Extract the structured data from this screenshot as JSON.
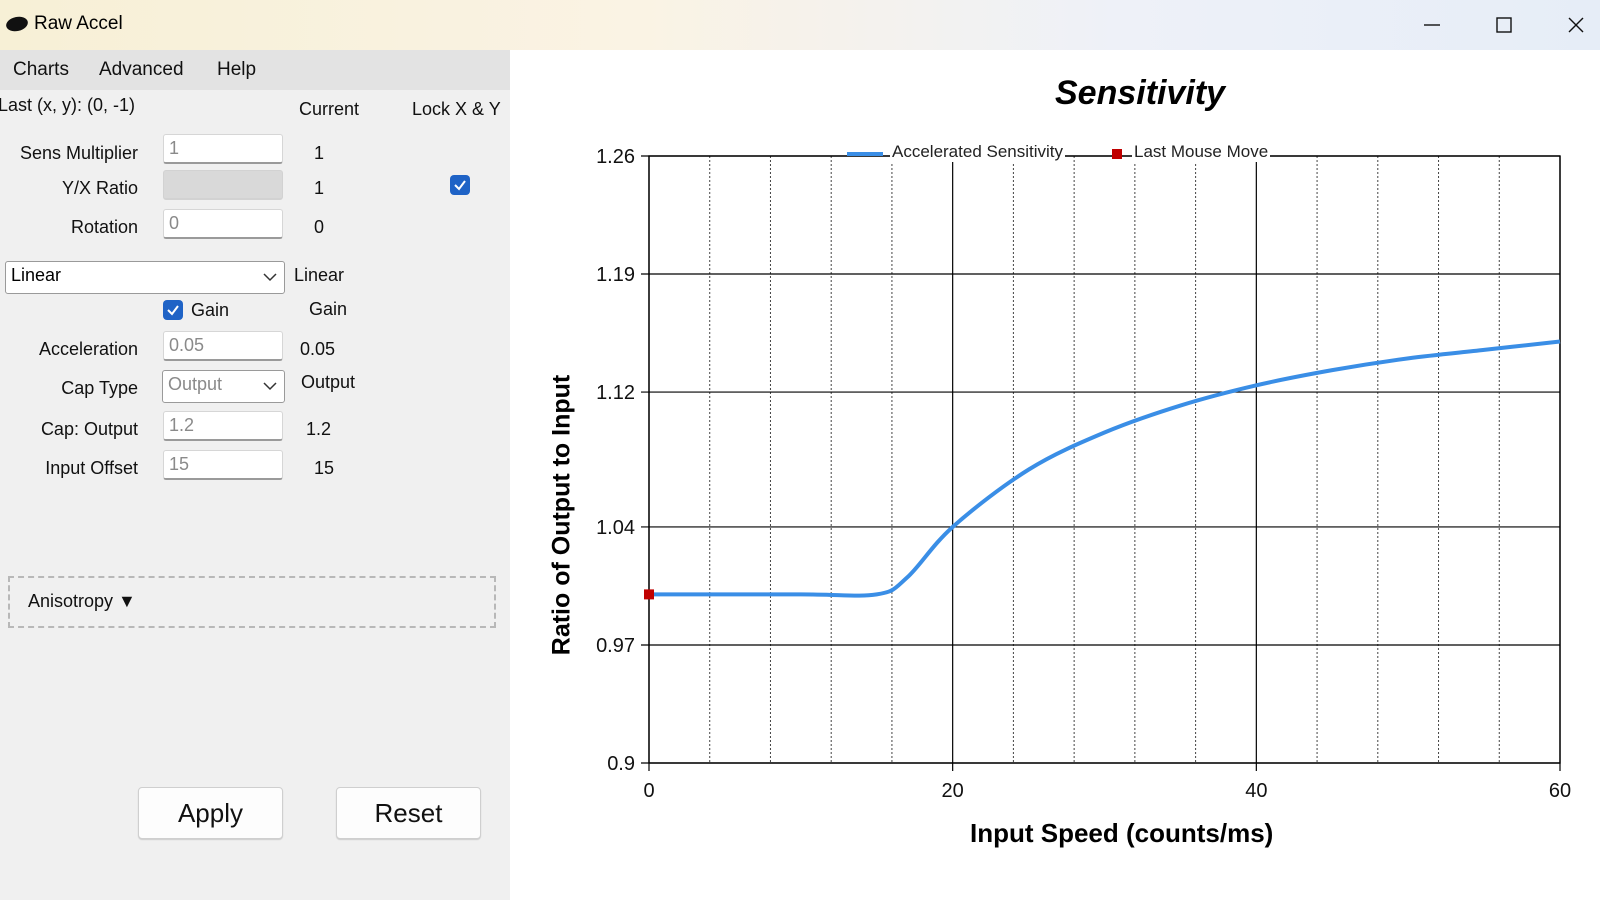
{
  "app": {
    "title": "Raw Accel"
  },
  "menu": {
    "items": [
      "Charts",
      "Advanced",
      "Help"
    ]
  },
  "panel": {
    "last_xy": "Last (x, y): (0, -1)",
    "current_header": "Current",
    "lock_header": "Lock X & Y",
    "sens_label": "Sens Multiplier",
    "sens_value": "1",
    "sens_current": "1",
    "yx_label": "Y/X Ratio",
    "yx_value": "",
    "yx_current": "1",
    "rotation_label": "Rotation",
    "rotation_value": "0",
    "rotation_current": "0",
    "mode_value": "Linear",
    "mode_current": "Linear",
    "gain_label": "Gain",
    "gain_current": "Gain",
    "accel_label": "Acceleration",
    "accel_value": "0.05",
    "accel_current": "0.05",
    "captype_label": "Cap Type",
    "captype_value": "Output",
    "captype_current": "Output",
    "capout_label": "Cap: Output",
    "capout_value": "1.2",
    "capout_current": "1.2",
    "offset_label": "Input Offset",
    "offset_value": "15",
    "offset_current": "15",
    "aniso_label": "Anisotropy ▼",
    "apply_label": "Apply",
    "reset_label": "Reset"
  },
  "chart_data": {
    "type": "line",
    "title": "Sensitivity",
    "xlabel": "Input Speed (counts/ms)",
    "ylabel": "Ratio of Output to Input",
    "xlim": [
      0,
      60
    ],
    "ylim": [
      0.9,
      1.26
    ],
    "xticks": [
      "0",
      "20",
      "40",
      "60"
    ],
    "yticks": [
      "0.9",
      "0.97",
      "1.04",
      "1.12",
      "1.19",
      "1.26"
    ],
    "series": [
      {
        "name": "Accelerated Sensitivity",
        "color": "#3a8ee6",
        "x": [
          0,
          10,
          15,
          17,
          20,
          25,
          30,
          35,
          40,
          45,
          50,
          55,
          60
        ],
        "y": [
          1.0,
          1.0,
          1.0,
          1.01,
          1.04,
          1.074,
          1.096,
          1.112,
          1.124,
          1.133,
          1.14,
          1.145,
          1.15
        ]
      },
      {
        "name": "Last Mouse Move",
        "color": "#c00000",
        "type": "scatter",
        "x": [
          0
        ],
        "y": [
          1.0
        ]
      }
    ],
    "legend_position": "top",
    "grid": true
  }
}
